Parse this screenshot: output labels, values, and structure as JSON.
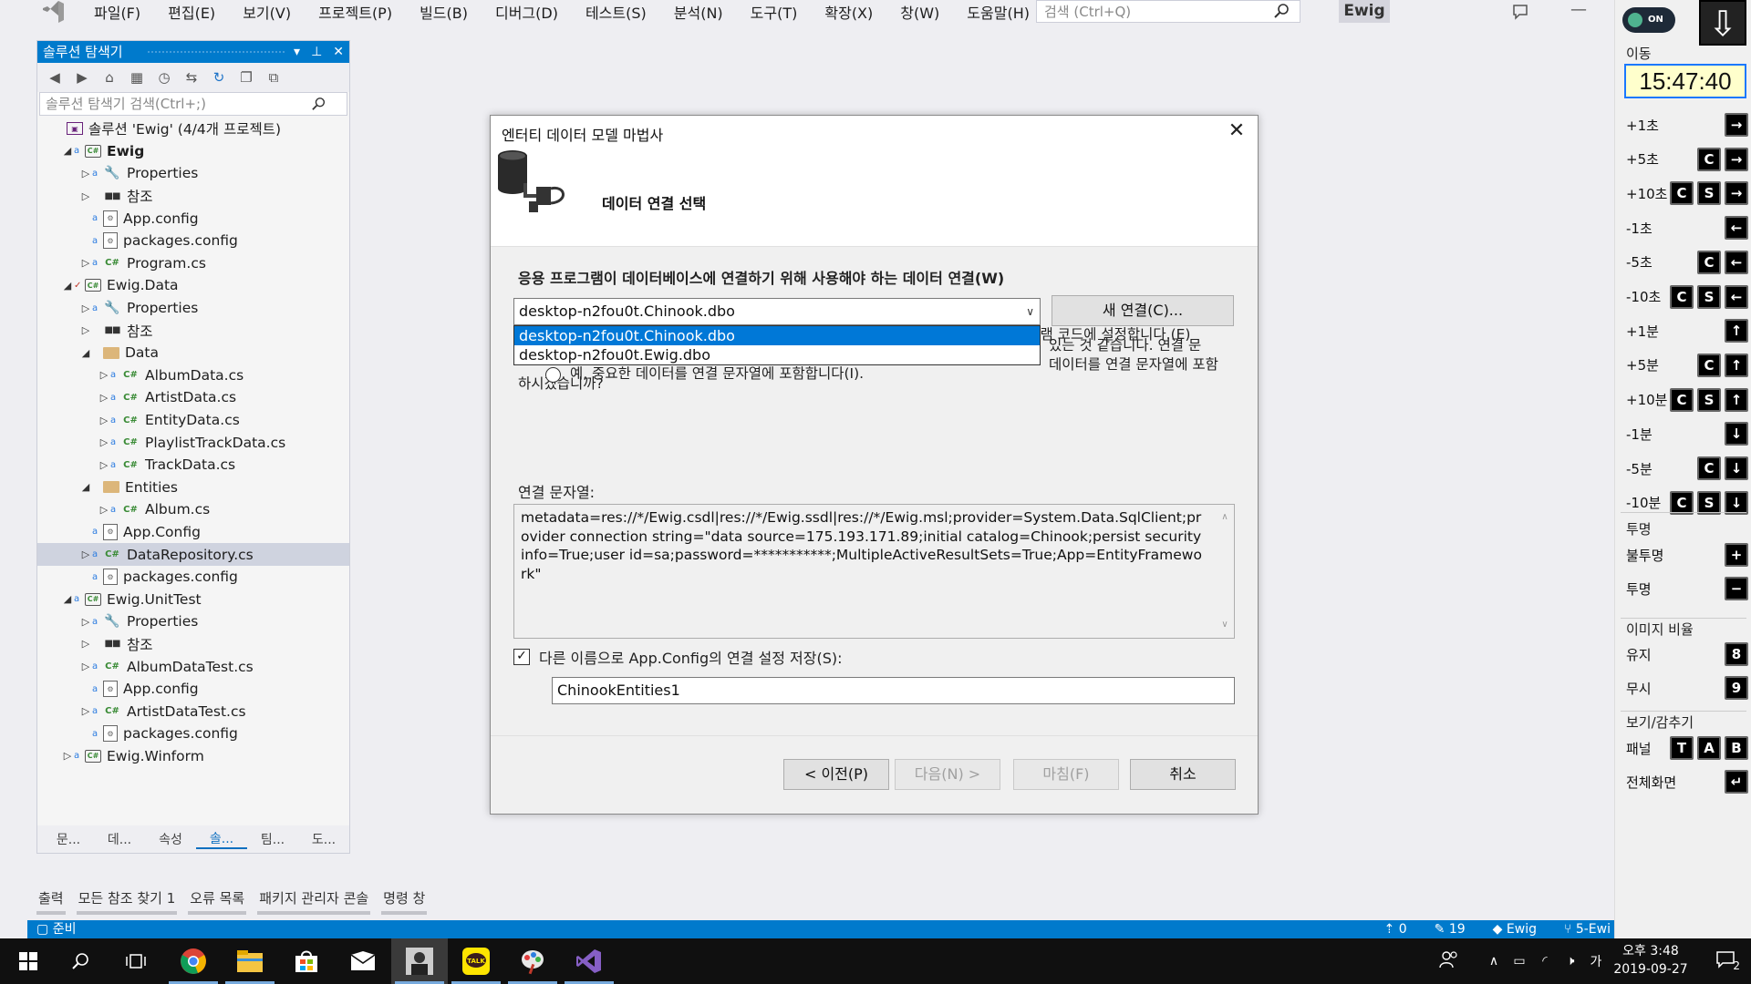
{
  "menu": {
    "items": [
      "파일(F)",
      "편집(E)",
      "보기(V)",
      "프로젝트(P)",
      "빌드(B)",
      "디버그(D)",
      "테스트(S)",
      "분석(N)",
      "도구(T)",
      "확장(X)",
      "창(W)",
      "도움말(H)"
    ],
    "search_placeholder": "검색 (Ctrl+Q)",
    "solution_name": "Ewig"
  },
  "solution_explorer": {
    "title": "솔루션 탐색기",
    "search_placeholder": "솔루션 탐색기 검색(Ctrl+;)",
    "nodes": [
      {
        "label": "솔루션 'Ewig' (4/4개 프로젝트)",
        "depth": 0,
        "arrow": "",
        "icon": "sln",
        "lock": false
      },
      {
        "label": "Ewig",
        "depth": 1,
        "arrow": "◢",
        "icon": "proj",
        "lock": true,
        "bold": true
      },
      {
        "label": "Properties",
        "depth": 2,
        "arrow": "▷",
        "icon": "wrench",
        "lock": true
      },
      {
        "label": "참조",
        "depth": 2,
        "arrow": "▷",
        "icon": "ref",
        "lock": false
      },
      {
        "label": "App.config",
        "depth": 2,
        "arrow": "",
        "icon": "config",
        "lock": true
      },
      {
        "label": "packages.config",
        "depth": 2,
        "arrow": "",
        "icon": "config",
        "lock": true
      },
      {
        "label": "Program.cs",
        "depth": 2,
        "arrow": "▷",
        "icon": "cs",
        "lock": true
      },
      {
        "label": "Ewig.Data",
        "depth": 1,
        "arrow": "◢",
        "icon": "proj",
        "lock": false,
        "check": true
      },
      {
        "label": "Properties",
        "depth": 2,
        "arrow": "▷",
        "icon": "wrench",
        "lock": true
      },
      {
        "label": "참조",
        "depth": 2,
        "arrow": "▷",
        "icon": "ref",
        "lock": false
      },
      {
        "label": "Data",
        "depth": 2,
        "arrow": "◢",
        "icon": "folder",
        "lock": false
      },
      {
        "label": "AlbumData.cs",
        "depth": 3,
        "arrow": "▷",
        "icon": "cs",
        "lock": true
      },
      {
        "label": "ArtistData.cs",
        "depth": 3,
        "arrow": "▷",
        "icon": "cs",
        "lock": true
      },
      {
        "label": "EntityData.cs",
        "depth": 3,
        "arrow": "▷",
        "icon": "cs",
        "lock": true
      },
      {
        "label": "PlaylistTrackData.cs",
        "depth": 3,
        "arrow": "▷",
        "icon": "cs",
        "lock": true
      },
      {
        "label": "TrackData.cs",
        "depth": 3,
        "arrow": "▷",
        "icon": "cs",
        "lock": true
      },
      {
        "label": "Entities",
        "depth": 2,
        "arrow": "◢",
        "icon": "folder",
        "lock": false
      },
      {
        "label": "Album.cs",
        "depth": 3,
        "arrow": "▷",
        "icon": "cs",
        "lock": true
      },
      {
        "label": "App.Config",
        "depth": 2,
        "arrow": "",
        "icon": "config",
        "lock": true
      },
      {
        "label": "DataRepository.cs",
        "depth": 2,
        "arrow": "▷",
        "icon": "cs",
        "lock": true,
        "selected": true
      },
      {
        "label": "packages.config",
        "depth": 2,
        "arrow": "",
        "icon": "config",
        "lock": true
      },
      {
        "label": "Ewig.UnitTest",
        "depth": 1,
        "arrow": "◢",
        "icon": "proj",
        "lock": true
      },
      {
        "label": "Properties",
        "depth": 2,
        "arrow": "▷",
        "icon": "wrench",
        "lock": true
      },
      {
        "label": "참조",
        "depth": 2,
        "arrow": "▷",
        "icon": "ref",
        "lock": false
      },
      {
        "label": "AlbumDataTest.cs",
        "depth": 2,
        "arrow": "▷",
        "icon": "cs",
        "lock": true
      },
      {
        "label": "App.config",
        "depth": 2,
        "arrow": "",
        "icon": "config",
        "lock": true
      },
      {
        "label": "ArtistDataTest.cs",
        "depth": 2,
        "arrow": "▷",
        "icon": "cs",
        "lock": true
      },
      {
        "label": "packages.config",
        "depth": 2,
        "arrow": "",
        "icon": "config",
        "lock": true
      },
      {
        "label": "Ewig.Winform",
        "depth": 1,
        "arrow": "▷",
        "icon": "proj",
        "lock": true
      }
    ],
    "tabs": [
      "문...",
      "데...",
      "속성",
      "솔...",
      "팀...",
      "도..."
    ],
    "active_tab": 3
  },
  "tool_tabs": [
    "출력",
    "모든 참조 찾기 1",
    "오류 목록",
    "패키지 관리자 콘솔",
    "명령 창"
  ],
  "status": {
    "ready": "준비",
    "up_count": "0",
    "edit_count": "19",
    "repo": "Ewig",
    "branch": "5-Ewi"
  },
  "dialog": {
    "title": "엔터티 데이터 모델 마법사",
    "step_title": "데이터 연결 선택",
    "question": "응용 프로그램이 데이터베이스에 연결하기 위해 사용해야 하는 데이터 연결(W)",
    "selected_connection": "desktop-n2fou0t.Chinook.dbo",
    "new_connection_button": "새 연결(C)...",
    "dropdown_options": [
      "desktop-n2fou0t.Chinook.dbo",
      "desktop-n2fou0t.Ewig.dbo"
    ],
    "warning_line1": "있는 것 같습니다. 연결 문",
    "warning_line2": "데이터를 연결 문자열에 포함",
    "warning_line3": "하시겠습니까?",
    "radio_no": "아니요, 중요한 데이터를 연결 문자열에서 제외합니다. 이 정보는 내 응용 프로그램 코드에 설정합니다.(E)",
    "radio_yes": "예, 중요한 데이터를 연결 문자열에 포함합니다(I).",
    "conn_string_label": "연결 문자열:",
    "conn_string": "metadata=res://*/Ewig.csdl|res://*/Ewig.ssdl|res://*/Ewig.msl;provider=System.Data.SqlClient;provider connection string=\"data source=175.193.171.89;initial catalog=Chinook;persist security info=True;user id=sa;password=***********;MultipleActiveResultSets=True;App=EntityFramework\"",
    "save_checkbox_label": "다른 이름으로 App.Config의 연결 설정 저장(S):",
    "save_checked": true,
    "entities_name": "ChinookEntities1",
    "btn_prev": "< 이전(P)",
    "btn_next": "다음(N) >",
    "btn_finish": "마침(F)",
    "btn_cancel": "취소"
  },
  "right_panel": {
    "toggle": "ON",
    "move_label": "이동",
    "time": "15:47:40",
    "move_rows": [
      {
        "label": "+1초",
        "keys": [
          "→"
        ]
      },
      {
        "label": "+5초",
        "keys": [
          "C",
          "→"
        ]
      },
      {
        "label": "+10초",
        "keys": [
          "C",
          "S",
          "→"
        ]
      },
      {
        "label": "-1초",
        "keys": [
          "←"
        ]
      },
      {
        "label": "-5초",
        "keys": [
          "C",
          "←"
        ]
      },
      {
        "label": "-10초",
        "keys": [
          "C",
          "S",
          "←"
        ]
      },
      {
        "label": "+1분",
        "keys": [
          "↑"
        ]
      },
      {
        "label": "+5분",
        "keys": [
          "C",
          "↑"
        ]
      },
      {
        "label": "+10분",
        "keys": [
          "C",
          "S",
          "↑"
        ]
      },
      {
        "label": "-1분",
        "keys": [
          "↓"
        ]
      },
      {
        "label": "-5분",
        "keys": [
          "C",
          "↓"
        ]
      },
      {
        "label": "-10분",
        "keys": [
          "C",
          "S",
          "↓"
        ]
      }
    ],
    "opacity_label": "투명",
    "opaque": "불투명",
    "transparent": "투명",
    "opaque_key": "+",
    "transparent_key": "−",
    "ratio_label": "이미지 비율",
    "keep": "유지",
    "keep_key": "8",
    "ignore": "무시",
    "ignore_key": "9",
    "view_label": "보기/감추기",
    "panel": "패널",
    "panel_keys": [
      "T",
      "A",
      "B"
    ],
    "fullscreen": "전체화면",
    "fullscreen_key": "↵"
  },
  "taskbar": {
    "time": "오후 3:48",
    "date": "2019-09-27",
    "ime": "가",
    "notif_count": "2"
  }
}
